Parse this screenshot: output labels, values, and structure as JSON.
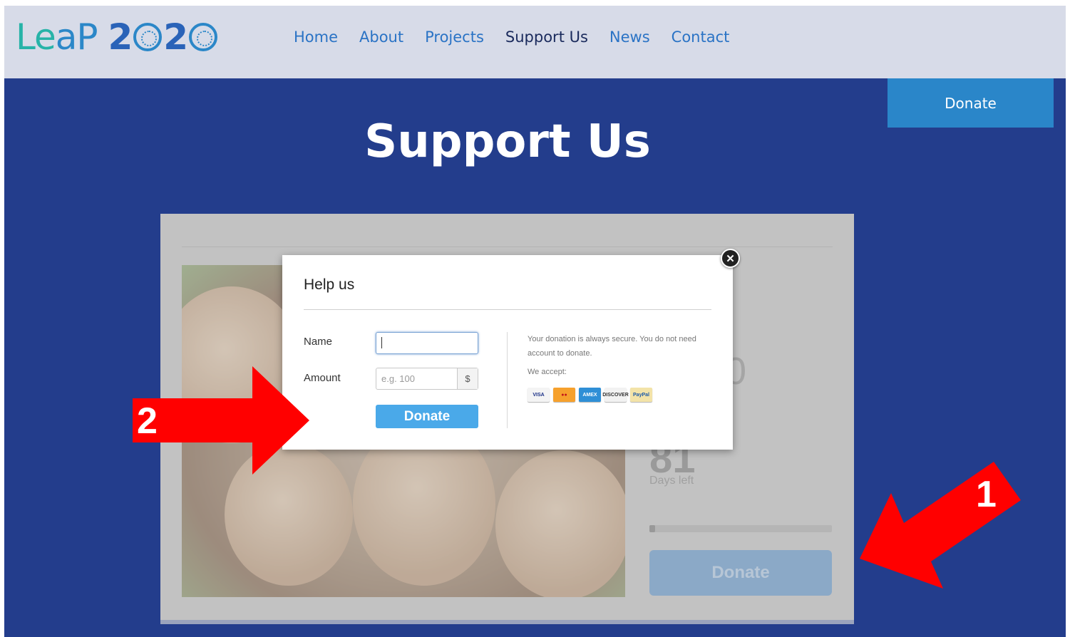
{
  "header": {
    "logo": {
      "part1": "Le",
      "part2": "aP",
      "part3": "2",
      "part4": "2"
    },
    "nav": [
      {
        "label": "Home",
        "active": false
      },
      {
        "label": "About",
        "active": false
      },
      {
        "label": "Projects",
        "active": false
      },
      {
        "label": "Support Us",
        "active": true
      },
      {
        "label": "News",
        "active": false
      },
      {
        "label": "Contact",
        "active": false
      }
    ],
    "donate_label": "Donate"
  },
  "hero": {
    "title": "Support Us"
  },
  "campaign": {
    "big_number": "81",
    "days_left_label": "Days left",
    "partial_number": "0",
    "progress": 0.03,
    "donate_label": "Donate"
  },
  "modal": {
    "title": "Help us",
    "name_label": "Name",
    "name_value": "",
    "amount_label": "Amount",
    "amount_placeholder": "e.g. 100",
    "currency": "$",
    "donate_label": "Donate",
    "secure_text": "Your donation is always secure. You do not need account to donate.",
    "accept_label": "We accept:",
    "cards": [
      {
        "name": "VISA",
        "icon": "visa-icon",
        "bg": "#f4f4f4",
        "fg": "#1a2f86"
      },
      {
        "name": "MasterCard",
        "icon": "mastercard-icon",
        "bg": "#f6a12d",
        "fg": "#c2151b"
      },
      {
        "name": "AMEX",
        "icon": "amex-icon",
        "bg": "#2f8fd6",
        "fg": "#ffffff"
      },
      {
        "name": "DISCOVER",
        "icon": "discover-icon",
        "bg": "#f2f2f2",
        "fg": "#333333"
      },
      {
        "name": "PayPal",
        "icon": "paypal-icon",
        "bg": "#f3e3a8",
        "fg": "#1c5aa8"
      }
    ],
    "close_icon": "close-icon"
  },
  "annotations": {
    "arrow1_label": "1",
    "arrow2_label": "2",
    "arrow_color": "#ff0000"
  },
  "colors": {
    "header_bg": "#d7dbe8",
    "hero_bg": "#233d8c",
    "accent": "#2a86c9",
    "modal_button": "#4aa9e9"
  }
}
